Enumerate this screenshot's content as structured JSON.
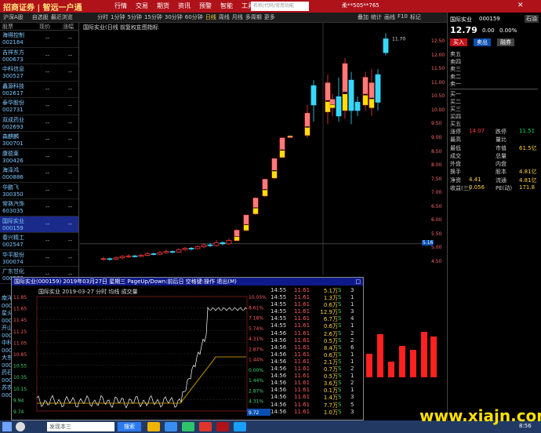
{
  "app": {
    "logo": "招商证券 | 智远一户通",
    "menu": [
      "行情",
      "交易",
      "期货",
      "资讯",
      "预警",
      "智能",
      "工具",
      "帮助"
    ],
    "search_placeholder": "名称/代码/常用功能",
    "user": "柔**505**765"
  },
  "toolbar": {
    "left": [
      "沪深A股",
      "自选股",
      "最近浏览"
    ],
    "periods": [
      "分时",
      "1分钟",
      "5分钟",
      "15分钟",
      "30分钟",
      "60分钟",
      "日线",
      "周线",
      "月线",
      "多周期",
      "更多"
    ],
    "right": [
      "叠加",
      "统计",
      "画线",
      "F10",
      "标记"
    ]
  },
  "left_panel": {
    "header": [
      "股票",
      "现价",
      "涨幅"
    ],
    "stocks": [
      {
        "name": "海得控制",
        "code": "002184",
        "a": "--",
        "b": "--"
      },
      {
        "name": "吉祥东方",
        "code": "000673",
        "a": "--",
        "b": "--"
      },
      {
        "name": "中科信息",
        "code": "300527",
        "a": "--",
        "b": "--"
      },
      {
        "name": "鑫源科技",
        "code": "002617",
        "a": "--",
        "b": "--"
      },
      {
        "name": "泰华股份",
        "code": "002731",
        "a": "--",
        "b": "--"
      },
      {
        "name": "双成药业",
        "code": "002693",
        "a": "--",
        "b": "--"
      },
      {
        "name": "森麒麟",
        "code": "300701",
        "a": "--",
        "b": "--"
      },
      {
        "name": "康德莱",
        "code": "300426",
        "a": "--",
        "b": "--"
      },
      {
        "name": "海泽鸿",
        "code": "000886",
        "a": "--",
        "b": "--"
      },
      {
        "name": "华鹏飞",
        "code": "300350",
        "a": "--",
        "b": "--"
      },
      {
        "name": "常熟汽饰",
        "code": "603035",
        "a": "--",
        "b": "--"
      },
      {
        "name": "国际实业",
        "code": "000159",
        "a": "--",
        "b": "--",
        "selected": true
      },
      {
        "name": "春兴精工",
        "code": "002547",
        "a": "--",
        "b": "--"
      },
      {
        "name": "华平股份",
        "code": "300074",
        "a": "--",
        "b": "--"
      },
      {
        "name": "广东甘化",
        "code": "000576",
        "a": "--",
        "b": "--"
      }
    ],
    "partial": [
      "南洋",
      "0006",
      "星火",
      "0006",
      "开山",
      "0006",
      "中科",
      "0006",
      "大东",
      "0006",
      "药石",
      "0006",
      "苏农",
      "0006"
    ]
  },
  "kchart": {
    "title": "国际实业(日线 前复权)",
    "indicator": "主图指标",
    "y_labels": [
      "12.50",
      "12.00",
      "11.50",
      "11.00",
      "10.50",
      "10.00",
      "9.50",
      "9.00",
      "8.50",
      "8.00",
      "7.50",
      "7.00",
      "6.50",
      "6.00",
      "5.50",
      "5.00",
      "4.50"
    ],
    "price_tag": "5.16",
    "top_label": "11.70"
  },
  "quote": {
    "title": "国际实业",
    "code": "000159",
    "badge": "石油",
    "price": "12.79",
    "change": "0.00",
    "pct": "0.00%",
    "buttons": [
      "买入",
      "卖出",
      "融券"
    ],
    "sell_rows": [
      "卖五",
      "卖四",
      "卖三",
      "卖二",
      "卖一"
    ],
    "buy_rows": [
      "买一",
      "买二",
      "买三",
      "买四",
      "买五"
    ],
    "stats": [
      [
        "涨停",
        "14.07",
        "跌停",
        "11.51"
      ],
      [
        "最高",
        "",
        "量比",
        ""
      ],
      [
        "最低",
        "",
        "市值",
        "61.5亿"
      ],
      [
        "成交",
        "",
        "总量",
        ""
      ],
      [
        "外盘",
        "",
        "内盘",
        ""
      ],
      [
        "换手",
        "",
        "股本",
        "4.81亿"
      ],
      [
        "净资",
        "4.41",
        "流通",
        "4.81亿"
      ],
      [
        "收益(三)",
        "0.056",
        "PE(动)",
        "171.8"
      ]
    ]
  },
  "popup": {
    "title": "国际实业(000159) 2019年03月27日 星期三 PageUp/Down:前后日 空格键:操作 退出(M)",
    "chart_header": "国际实业  2019-03-27 分时 均线 成交量",
    "y_left": [
      "11.85",
      "11.65",
      "11.45",
      "11.25",
      "11.05",
      "10.85",
      "10.55",
      "10.35",
      "10.15",
      "9.94",
      "9.74"
    ],
    "y_right": [
      "10.05%",
      "8.61%",
      "7.18%",
      "5.74%",
      "4.31%",
      "2.87%",
      "1.44%",
      "0.00%",
      "1.44%",
      "2.87%",
      "4.31%",
      "5.74%"
    ],
    "price_tag": "9.72",
    "ticks": [
      [
        "14:55",
        "11.61",
        "5.1万",
        "S",
        "3"
      ],
      [
        "14:55",
        "11.61",
        "1.3万",
        "S",
        "1"
      ],
      [
        "14:55",
        "11.61",
        "0.6万",
        "S",
        "1"
      ],
      [
        "14:55",
        "11.61",
        "12.9万",
        "S",
        "3"
      ],
      [
        "14:55",
        "11.61",
        "6.7万",
        "S",
        "4"
      ],
      [
        "14:55",
        "11.61",
        "0.6万",
        "S",
        "1"
      ],
      [
        "14:56",
        "11.61",
        "2.6万",
        "S",
        "2"
      ],
      [
        "14:56",
        "11.61",
        "0.5万",
        "S",
        "2"
      ],
      [
        "14:56",
        "11.61",
        "8.4万",
        "S",
        "6"
      ],
      [
        "14:56",
        "11.61",
        "0.6万",
        "S",
        "1"
      ],
      [
        "14:56",
        "11.61",
        "2.1万",
        "S",
        "1"
      ],
      [
        "14:56",
        "11.61",
        "0.7万",
        "S",
        "2"
      ],
      [
        "14:56",
        "11.61",
        "0.5万",
        "S",
        "1"
      ],
      [
        "14:56",
        "11.61",
        "3.6万",
        "S",
        "2"
      ],
      [
        "14:56",
        "11.61",
        "0.1万",
        "S",
        "1"
      ],
      [
        "14:56",
        "11.61",
        "1.4万",
        "S",
        "3"
      ],
      [
        "14:56",
        "11.61",
        "7.7万",
        "S",
        "5"
      ],
      [
        "14:56",
        "11.61",
        "1.0万",
        "S",
        "3"
      ]
    ]
  },
  "taskbar": {
    "search": "发现本三",
    "baidu": "搜索",
    "time": "8:56"
  },
  "watermark": "www.xiajn.com",
  "colors": {
    "up": "#ff3b3b",
    "down": "#36d7ff",
    "title": "#b0121a"
  }
}
